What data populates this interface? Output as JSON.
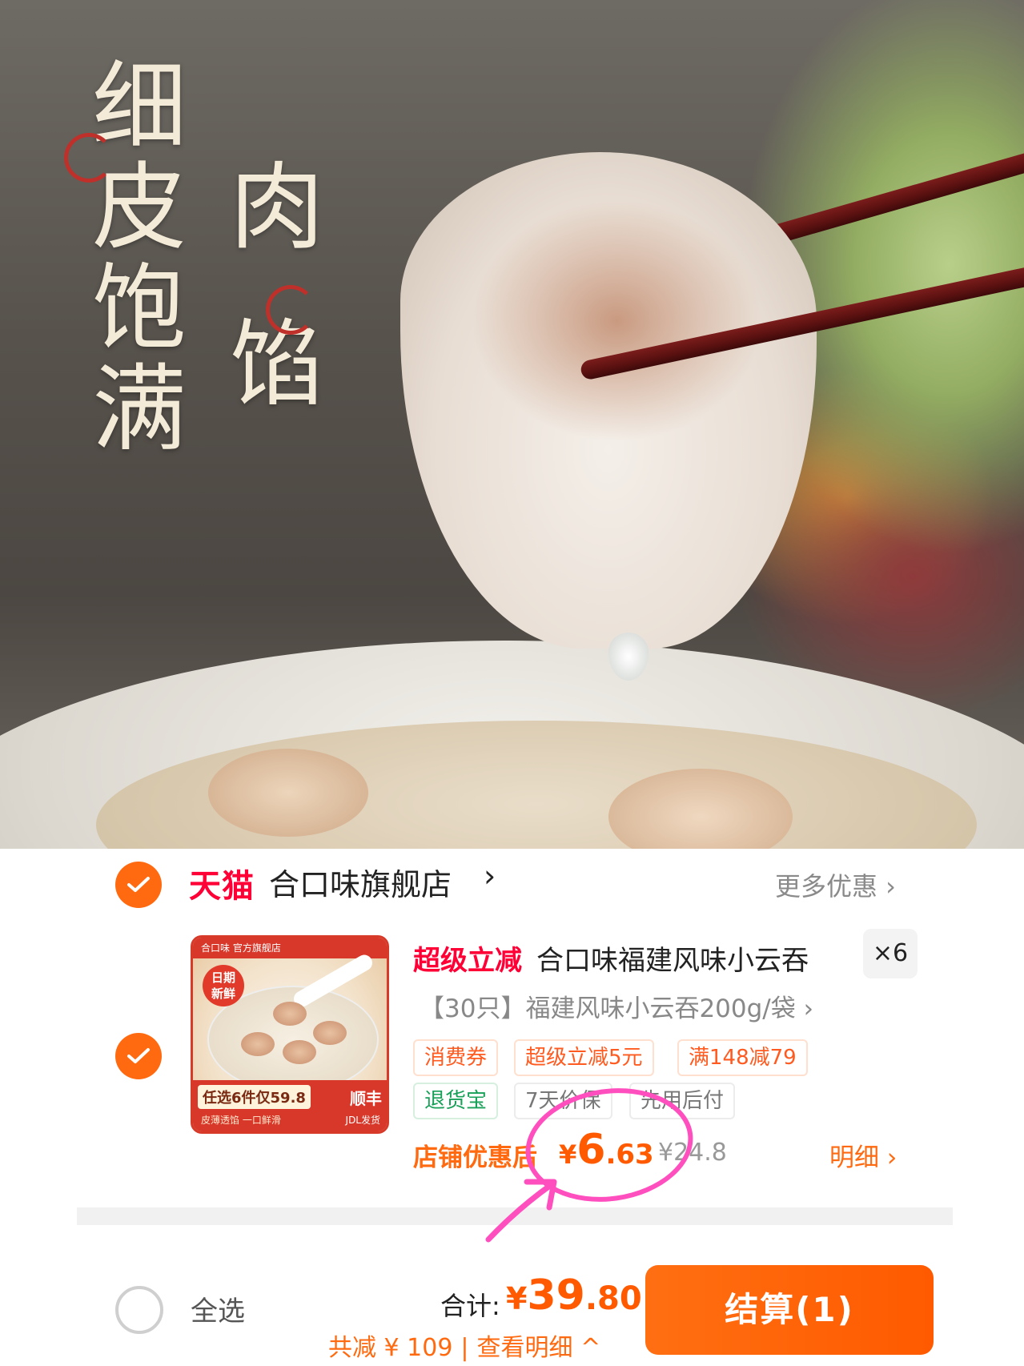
{
  "hero": {
    "headline_col1": [
      "细",
      "皮",
      "饱",
      "满"
    ],
    "headline_col2": [
      "肉",
      "馅"
    ]
  },
  "store": {
    "brand": "天猫",
    "name": "合口味旗舰店",
    "arrow": "›",
    "more_deals": "更多优惠 ›"
  },
  "product": {
    "thumbnail": {
      "top_banner": "合口味 官方旗舰店",
      "fresh_badge": "日期\n新鲜",
      "promo": "任选6件仅59.8",
      "shipping": "顺丰",
      "slogan": "皮薄透馅 一口鲜滑",
      "delivery": "JDL发货"
    },
    "promo_tag": "超级立减",
    "title": "合口味福建风味小云吞",
    "quantity": "×6",
    "sku": "【30只】福建风味小云吞200g/袋 ›",
    "tags_row1": [
      "消费券",
      "超级立减5元",
      "满148减79"
    ],
    "tags_row2": [
      "退货宝",
      "7天价保",
      "先用后付"
    ],
    "after_discount_label": "店铺优惠后",
    "after_discount_currency": "¥",
    "after_discount_int": "6",
    "after_discount_dec": ".63",
    "original_price": "¥24.8",
    "detail_link": "明细 ›"
  },
  "footer": {
    "select_all": "全选",
    "total_label": "合计:",
    "total_currency": "¥",
    "total_int": "39",
    "total_dec": ".80",
    "savings": "共减 ¥ 109",
    "view_detail": "查看明细 ^",
    "checkout": "结算(1)"
  },
  "colors": {
    "accent": "#ff6a10",
    "tmall_red": "#ff0036",
    "annotation_pink": "#ff4fbf"
  }
}
